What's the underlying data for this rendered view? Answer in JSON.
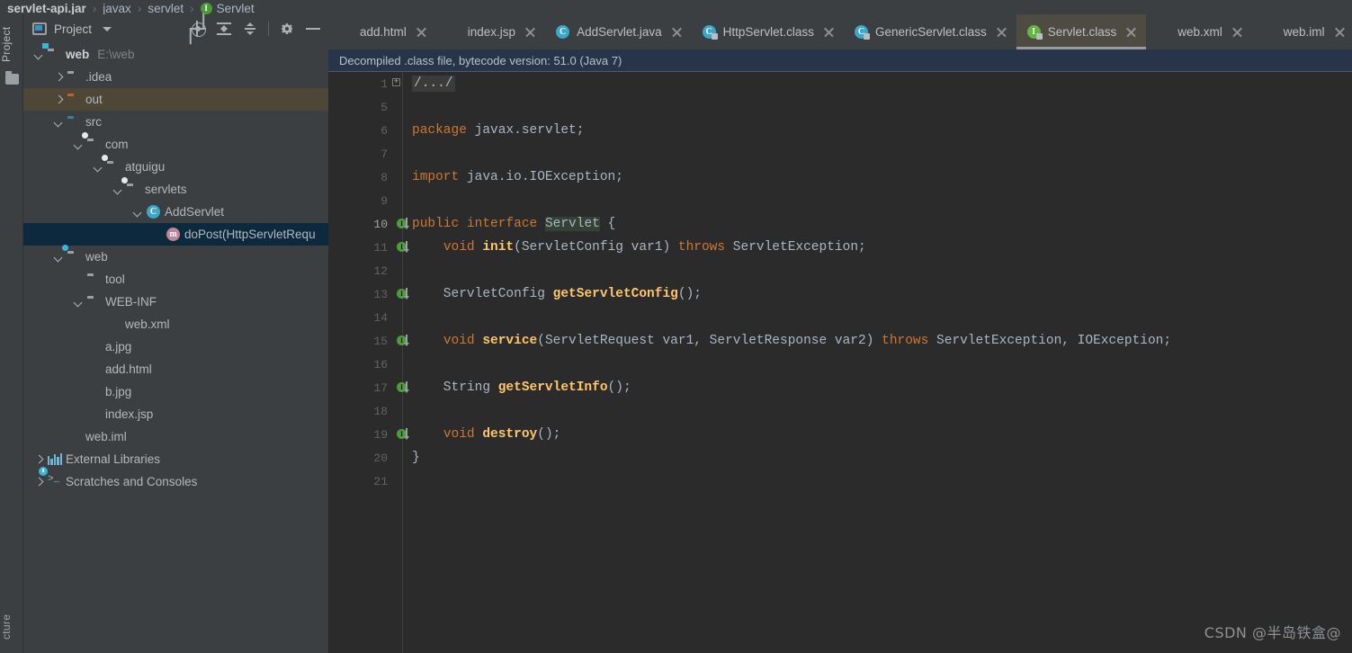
{
  "breadcrumb": {
    "items": [
      "servlet-api.jar",
      "javax",
      "servlet",
      "Servlet"
    ]
  },
  "left_strip": {
    "project_tab": "Project",
    "structure_tab": "cture"
  },
  "project_panel": {
    "title": "Project",
    "toolbar": {
      "locate": "locate-icon",
      "expand_all": "expand-all-icon",
      "collapse_all": "collapse-all-icon",
      "settings": "gear-icon",
      "minimize": "minimize-icon"
    },
    "tree": [
      {
        "label": "web",
        "secondary": "E:\\web",
        "indent": 0,
        "arrow": "down",
        "icon": "folder-module",
        "bold": true,
        "state": "none"
      },
      {
        "label": ".idea",
        "secondary": "",
        "indent": 1,
        "arrow": "right",
        "icon": "folder-grey",
        "bold": false,
        "state": "none"
      },
      {
        "label": "out",
        "secondary": "",
        "indent": 1,
        "arrow": "right",
        "icon": "folder-orange",
        "bold": false,
        "state": "olive"
      },
      {
        "label": "src",
        "secondary": "",
        "indent": 1,
        "arrow": "down",
        "icon": "folder-source",
        "bold": false,
        "state": "none"
      },
      {
        "label": "com",
        "secondary": "",
        "indent": 2,
        "arrow": "down",
        "icon": "folder-package",
        "bold": false,
        "state": "none"
      },
      {
        "label": "atguigu",
        "secondary": "",
        "indent": 3,
        "arrow": "down",
        "icon": "folder-package",
        "bold": false,
        "state": "none"
      },
      {
        "label": "servlets",
        "secondary": "",
        "indent": 4,
        "arrow": "down",
        "icon": "folder-package",
        "bold": false,
        "state": "none"
      },
      {
        "label": "AddServlet",
        "secondary": "",
        "indent": 5,
        "arrow": "down",
        "icon": "class-icon",
        "bold": false,
        "state": "none"
      },
      {
        "label": "doPost(HttpServletRequ",
        "secondary": "",
        "indent": 6,
        "arrow": "none",
        "icon": "method-icon",
        "bold": false,
        "state": "blue"
      },
      {
        "label": "web",
        "secondary": "",
        "indent": 1,
        "arrow": "down",
        "icon": "folder-web",
        "bold": false,
        "state": "none"
      },
      {
        "label": "tool",
        "secondary": "",
        "indent": 2,
        "arrow": "none",
        "icon": "folder-grey",
        "bold": false,
        "state": "none"
      },
      {
        "label": "WEB-INF",
        "secondary": "",
        "indent": 2,
        "arrow": "down",
        "icon": "folder-grey",
        "bold": false,
        "state": "none"
      },
      {
        "label": "web.xml",
        "secondary": "",
        "indent": 3,
        "arrow": "none",
        "icon": "xml-file",
        "bold": false,
        "state": "none"
      },
      {
        "label": "a.jpg",
        "secondary": "",
        "indent": 2,
        "arrow": "none",
        "icon": "image-file",
        "bold": false,
        "state": "none"
      },
      {
        "label": "add.html",
        "secondary": "",
        "indent": 2,
        "arrow": "none",
        "icon": "html-file",
        "bold": false,
        "state": "none"
      },
      {
        "label": "b.jpg",
        "secondary": "",
        "indent": 2,
        "arrow": "none",
        "icon": "image-file",
        "bold": false,
        "state": "none"
      },
      {
        "label": "index.jsp",
        "secondary": "",
        "indent": 2,
        "arrow": "none",
        "icon": "jsp-file",
        "bold": false,
        "state": "none"
      },
      {
        "label": "web.iml",
        "secondary": "",
        "indent": 1,
        "arrow": "none",
        "icon": "iml-file",
        "bold": false,
        "state": "none"
      },
      {
        "label": "External Libraries",
        "secondary": "",
        "indent": 0,
        "arrow": "right",
        "icon": "library-icon",
        "bold": false,
        "state": "none"
      },
      {
        "label": "Scratches and Consoles",
        "secondary": "",
        "indent": 0,
        "arrow": "right",
        "icon": "scratch-icon",
        "bold": false,
        "state": "none"
      }
    ]
  },
  "editor": {
    "tabs": [
      {
        "label": "add.html",
        "icon": "html-file",
        "active": false
      },
      {
        "label": "index.jsp",
        "icon": "jsp-file",
        "active": false
      },
      {
        "label": "AddServlet.java",
        "icon": "class-icon",
        "active": false
      },
      {
        "label": "HttpServlet.class",
        "icon": "class-locked-icon",
        "active": false
      },
      {
        "label": "GenericServlet.class",
        "icon": "class-locked-icon",
        "active": false
      },
      {
        "label": "Servlet.class",
        "icon": "interface-locked-icon",
        "active": true
      },
      {
        "label": "web.xml",
        "icon": "xml-file",
        "active": false
      },
      {
        "label": "web.iml",
        "icon": "iml-file",
        "active": false
      }
    ],
    "notice": "Decompiled .class file, bytecode version: 51.0 (Java 7)",
    "lines": [
      {
        "no": "1",
        "marker": false,
        "fold": true,
        "tokens": [
          {
            "t": "/.../",
            "c": "fold-txt"
          }
        ]
      },
      {
        "no": "5",
        "marker": false,
        "fold": false,
        "tokens": []
      },
      {
        "no": "6",
        "marker": false,
        "fold": false,
        "tokens": [
          {
            "t": "package ",
            "c": "kw"
          },
          {
            "t": "javax.servlet;",
            "c": "pun"
          }
        ]
      },
      {
        "no": "7",
        "marker": false,
        "fold": false,
        "tokens": []
      },
      {
        "no": "8",
        "marker": false,
        "fold": false,
        "tokens": [
          {
            "t": "import ",
            "c": "kw"
          },
          {
            "t": "java.io.IOException;",
            "c": "pun"
          }
        ]
      },
      {
        "no": "9",
        "marker": false,
        "fold": false,
        "tokens": []
      },
      {
        "no": "10",
        "marker": true,
        "fold": false,
        "tokens": [
          {
            "t": "public interface ",
            "c": "kw"
          },
          {
            "t": "Servlet",
            "c": "hl-ident"
          },
          {
            "t": " {",
            "c": "pun"
          }
        ]
      },
      {
        "no": "11",
        "marker": true,
        "fold": false,
        "tokens": [
          {
            "t": "    ",
            "c": "pun"
          },
          {
            "t": "void ",
            "c": "kw"
          },
          {
            "t": "init",
            "c": "mth"
          },
          {
            "t": "(ServletConfig var1) ",
            "c": "pun"
          },
          {
            "t": "throws ",
            "c": "kw"
          },
          {
            "t": "ServletException;",
            "c": "pun"
          }
        ]
      },
      {
        "no": "12",
        "marker": false,
        "fold": false,
        "tokens": []
      },
      {
        "no": "13",
        "marker": true,
        "fold": false,
        "tokens": [
          {
            "t": "    ServletConfig ",
            "c": "pun"
          },
          {
            "t": "getServletConfig",
            "c": "mth"
          },
          {
            "t": "();",
            "c": "pun"
          }
        ]
      },
      {
        "no": "14",
        "marker": false,
        "fold": false,
        "tokens": []
      },
      {
        "no": "15",
        "marker": true,
        "fold": false,
        "tokens": [
          {
            "t": "    ",
            "c": "pun"
          },
          {
            "t": "void ",
            "c": "kw"
          },
          {
            "t": "service",
            "c": "mth"
          },
          {
            "t": "(ServletRequest var1, ServletResponse var2) ",
            "c": "pun"
          },
          {
            "t": "throws ",
            "c": "kw"
          },
          {
            "t": "ServletException, IOException;",
            "c": "pun"
          }
        ]
      },
      {
        "no": "16",
        "marker": false,
        "fold": false,
        "tokens": []
      },
      {
        "no": "17",
        "marker": true,
        "fold": false,
        "tokens": [
          {
            "t": "    String ",
            "c": "pun"
          },
          {
            "t": "getServletInfo",
            "c": "mth"
          },
          {
            "t": "();",
            "c": "pun"
          }
        ]
      },
      {
        "no": "18",
        "marker": false,
        "fold": false,
        "tokens": []
      },
      {
        "no": "19",
        "marker": true,
        "fold": false,
        "tokens": [
          {
            "t": "    ",
            "c": "pun"
          },
          {
            "t": "void ",
            "c": "kw"
          },
          {
            "t": "destroy",
            "c": "mth"
          },
          {
            "t": "();",
            "c": "pun"
          }
        ]
      },
      {
        "no": "20",
        "marker": false,
        "fold": false,
        "tokens": [
          {
            "t": "}",
            "c": "pun"
          }
        ]
      },
      {
        "no": "21",
        "marker": false,
        "fold": false,
        "tokens": []
      }
    ]
  },
  "watermark": "CSDN @半岛铁盒@",
  "colors": {
    "panel_bg": "#3c3f41",
    "editor_bg": "#2b2b2b",
    "notice_bg": "#27344a",
    "selection_blue": "#0d293e",
    "selection_olive": "#4e4637",
    "keyword": "#cc7832",
    "method": "#ffc66d",
    "text": "#a9b7c6"
  }
}
